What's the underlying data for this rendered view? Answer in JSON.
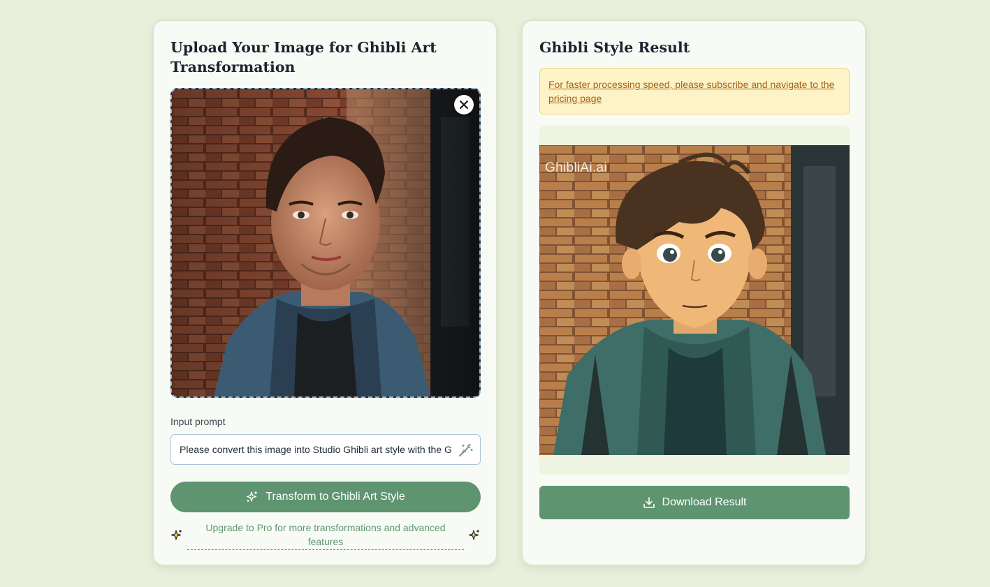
{
  "upload_card": {
    "title": "Upload Your Image for Ghibli Art Transformation",
    "remove_image_icon": "close-icon",
    "prompt": {
      "label": "Input prompt",
      "value": "Please convert this image into Studio Ghibli art style with the G",
      "enhance_icon": "magic-wand-icon"
    },
    "transform_button": {
      "label": "Transform to Ghibli Art Style",
      "icon": "sparkles-icon"
    },
    "upgrade": {
      "text": "Upgrade to Pro for more transformations and advanced features",
      "icon": "sparkles-icon"
    }
  },
  "result_card": {
    "title": "Ghibli Style Result",
    "notice": "For faster processing speed, please subscribe and navigate to the pricing page",
    "watermark": "GhibliAi.ai",
    "download_button": {
      "label": "Download Result",
      "icon": "download-icon"
    }
  },
  "colors": {
    "page_bg": "#e8f0dc",
    "card_bg": "#f8faf5",
    "accent_green": "#5e9470",
    "notice_bg": "#fdf3c7",
    "notice_text": "#a86214",
    "upload_border": "#8fb5cf"
  }
}
